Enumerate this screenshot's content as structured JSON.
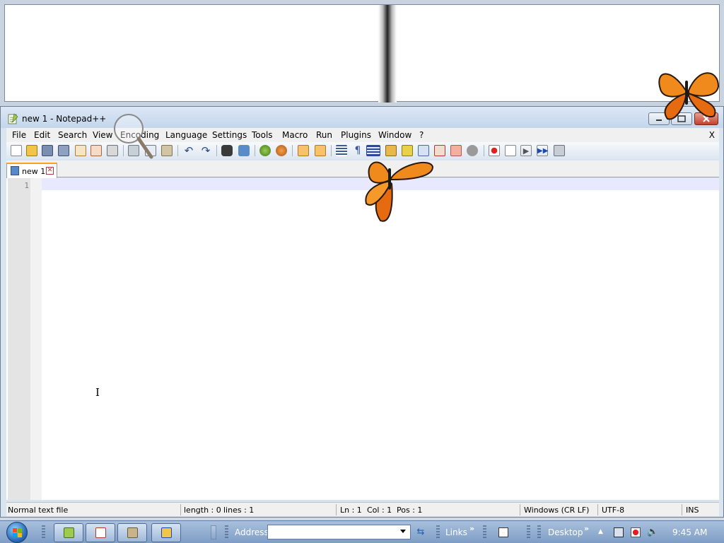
{
  "window": {
    "title": "new 1 - Notepad++"
  },
  "menu": {
    "items": [
      "File",
      "Edit",
      "Search",
      "View",
      "Encoding",
      "Language",
      "Settings",
      "Tools",
      "Macro",
      "Run",
      "Plugins",
      "Window",
      "?"
    ],
    "close_doc": "X"
  },
  "toolbar": {
    "buttons": [
      "new-file-icon",
      "open-file-icon",
      "save-icon",
      "save-all-icon",
      "close-icon",
      "close-all-icon",
      "print-icon",
      "cut-icon",
      "copy-icon",
      "paste-icon",
      "undo-icon",
      "redo-icon",
      "find-icon",
      "replace-icon",
      "zoom-in-icon",
      "zoom-out-icon",
      "sync-vertical-icon",
      "sync-horizontal-icon",
      "word-wrap-icon",
      "show-all-chars-icon",
      "indent-guide-icon",
      "user-language-icon",
      "doc-map-icon",
      "function-list-icon",
      "folder-workspace-icon",
      "monitoring-icon",
      "record-macro-icon",
      "stop-record-icon",
      "playback-icon",
      "run-multiple-icon",
      "save-macro-icon"
    ]
  },
  "tabs": [
    {
      "label": "new 1",
      "active": true
    }
  ],
  "editor": {
    "line_numbers": [
      "1"
    ],
    "content": ""
  },
  "statusbar": {
    "file_type": "Normal text file",
    "length": "length : 0",
    "lines": "lines : 1",
    "ln": "Ln : 1",
    "col": "Col : 1",
    "pos": "Pos : 1",
    "eol": "Windows (CR LF)",
    "encoding": "UTF-8",
    "mode": "INS"
  },
  "taskbar": {
    "address_label": "Address",
    "address_value": "",
    "links_label": "Links",
    "desktop_label": "Desktop",
    "clock": "9:45 AM"
  },
  "colors": {
    "accent_tab": "#f9a21c",
    "close_button": "#c4412c",
    "current_line": "#e8e8ff",
    "taskbar": "#7e9dc6",
    "butterfly": "#f08a1c"
  }
}
